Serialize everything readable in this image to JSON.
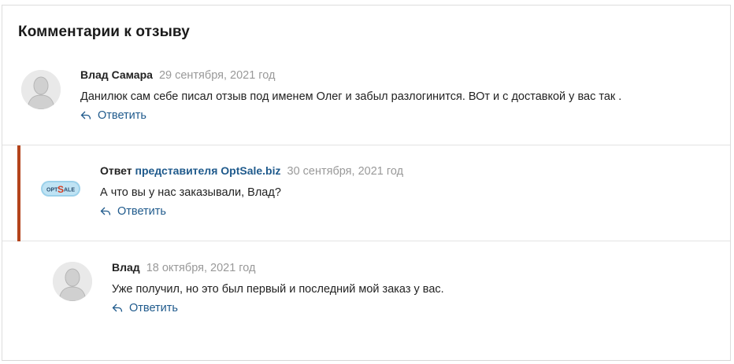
{
  "section": {
    "title": "Комментарии к отзыву"
  },
  "comments": [
    {
      "author": "Влад Самара",
      "date": "29 сентября, 2021 год",
      "text": "Данилюк сам себе писал отзыв под именем Олег и забыл разлогинится. ВОт и с доставкой у вас так .",
      "reply_label": "Ответить",
      "avatar_icon": "user-avatar-icon"
    },
    {
      "author_prefix": "Ответ",
      "author_link": "представителя OptSale.biz",
      "date": "30 сентября, 2021 год",
      "text": "А что вы у нас заказывали, Влад?",
      "reply_label": "Ответить",
      "logo_text_1": "OPT",
      "logo_text_2": "S",
      "logo_text_3": "ALE",
      "accent_color": "#b4441c"
    },
    {
      "author": "Влад",
      "date": "18 октября, 2021 год",
      "text": "Уже получил, но это был первый и последний мой заказ у вас.",
      "reply_label": "Ответить",
      "avatar_icon": "user-avatar-icon"
    }
  ],
  "colors": {
    "link": "#1f5a8c",
    "date": "#999999",
    "divider": "#e3e3e3"
  }
}
